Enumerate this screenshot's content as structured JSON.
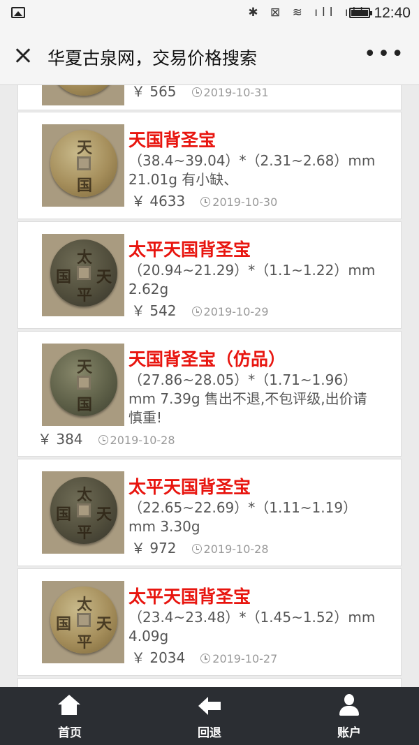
{
  "status_bar": {
    "time": "12:40",
    "icons": [
      "gallery-icon",
      "bluetooth-icon",
      "vibrate-icon",
      "wifi-icon",
      "signal-icon",
      "signal-icon",
      "battery-icon"
    ]
  },
  "header": {
    "title": "华夏古泉网，交易价格搜索",
    "more": "•••"
  },
  "listings": [
    {
      "title": "",
      "spec": "",
      "price": "￥ 565",
      "date": "2019-10-31"
    },
    {
      "title": "天国背圣宝",
      "spec": "（38.4~39.04）*（2.31~2.68）mm 21.01g 有小缺、",
      "price": "￥ 4633",
      "date": "2019-10-30"
    },
    {
      "title": "太平天国背圣宝",
      "spec": "（20.94~21.29）*（1.1~1.22）mm 2.62g",
      "price": "￥ 542",
      "date": "2019-10-29"
    },
    {
      "title": "天国背圣宝（仿品）",
      "spec": "（27.86~28.05）*（1.71~1.96）mm 7.39g 售出不退,不包评级,出价请慎重!",
      "price": "￥ 384",
      "date": "2019-10-28"
    },
    {
      "title": "太平天国背圣宝",
      "spec": "（22.65~22.69）*（1.11~1.19）mm 3.30g",
      "price": "￥ 972",
      "date": "2019-10-28"
    },
    {
      "title": "太平天国背圣宝",
      "spec": "（23.4~23.48）*（1.45~1.52）mm 4.09g",
      "price": "￥ 2034",
      "date": "2019-10-27"
    }
  ],
  "bottom_nav": {
    "home": "首页",
    "back": "回退",
    "account": "账户"
  },
  "colors": {
    "title_red": "#e8150f",
    "nav_bg": "#2b2e33"
  }
}
